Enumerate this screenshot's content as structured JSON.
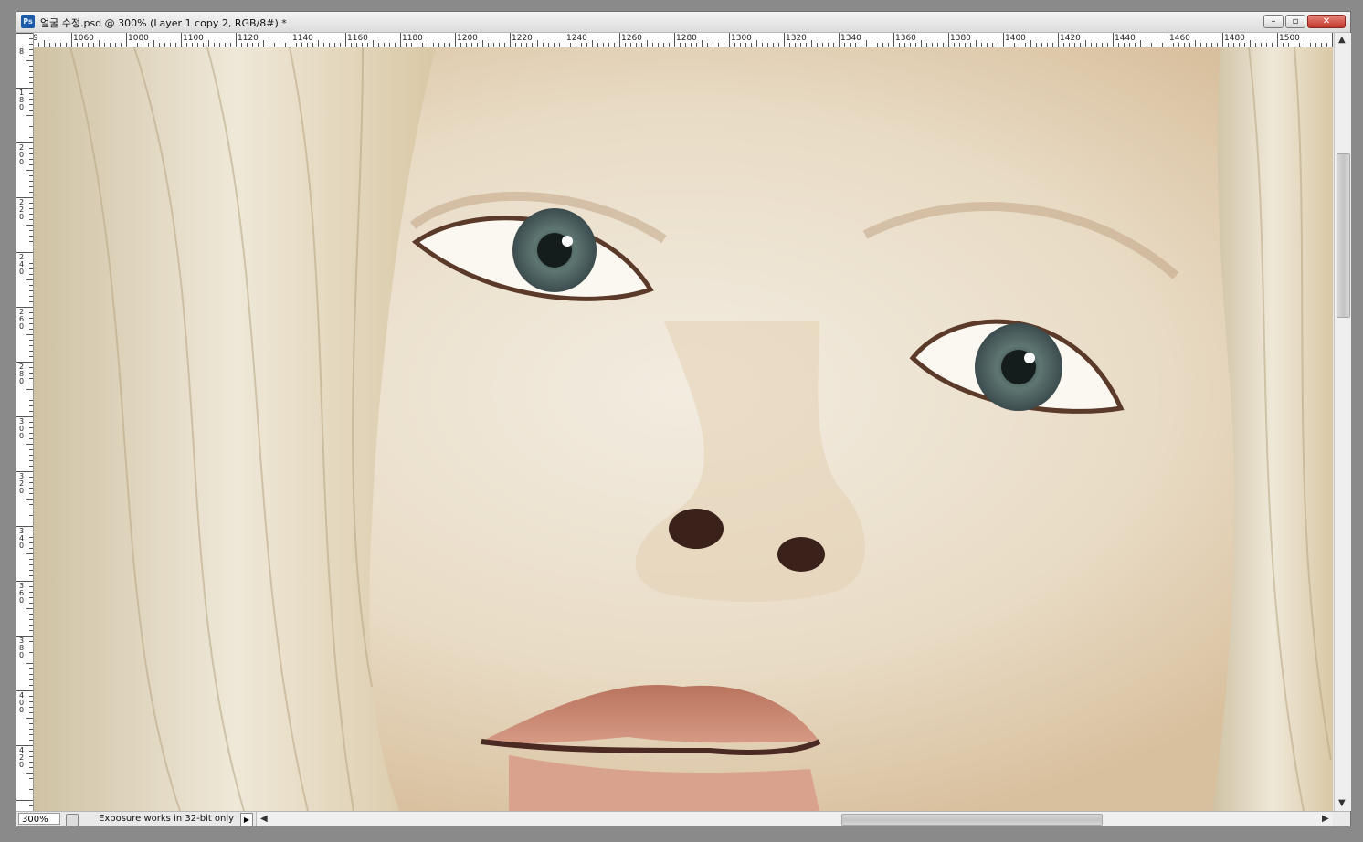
{
  "window": {
    "app_icon": "Ps",
    "title": "얼굴 수정.psd @ 300% (Layer 1 copy 2, RGB/8#) *",
    "controls": {
      "minimize": "minimize-icon",
      "restore": "restore-icon",
      "close": "close-icon"
    }
  },
  "ruler": {
    "top_labels": [
      "1060",
      "1080",
      "1100",
      "1120",
      "1140",
      "1160",
      "1180",
      "1200",
      "1220",
      "1240",
      "1260",
      "1280",
      "1300",
      "1320",
      "1340",
      "1360",
      "1380",
      "1400",
      "1420",
      "1440",
      "1460",
      "1480",
      "1500"
    ],
    "left_labels": [
      "180",
      "200",
      "220",
      "240",
      "260",
      "280",
      "300",
      "320",
      "340",
      "360",
      "380",
      "400",
      "420"
    ],
    "top_partial": "9",
    "left_partial": "8"
  },
  "status": {
    "zoom": "300%",
    "message": "Exposure works in 32-bit only",
    "menu_arrow": "▶"
  },
  "canvas": {
    "image": "photo of a young girl's face with blonde hair, close-up of eyes, nose and lips"
  }
}
